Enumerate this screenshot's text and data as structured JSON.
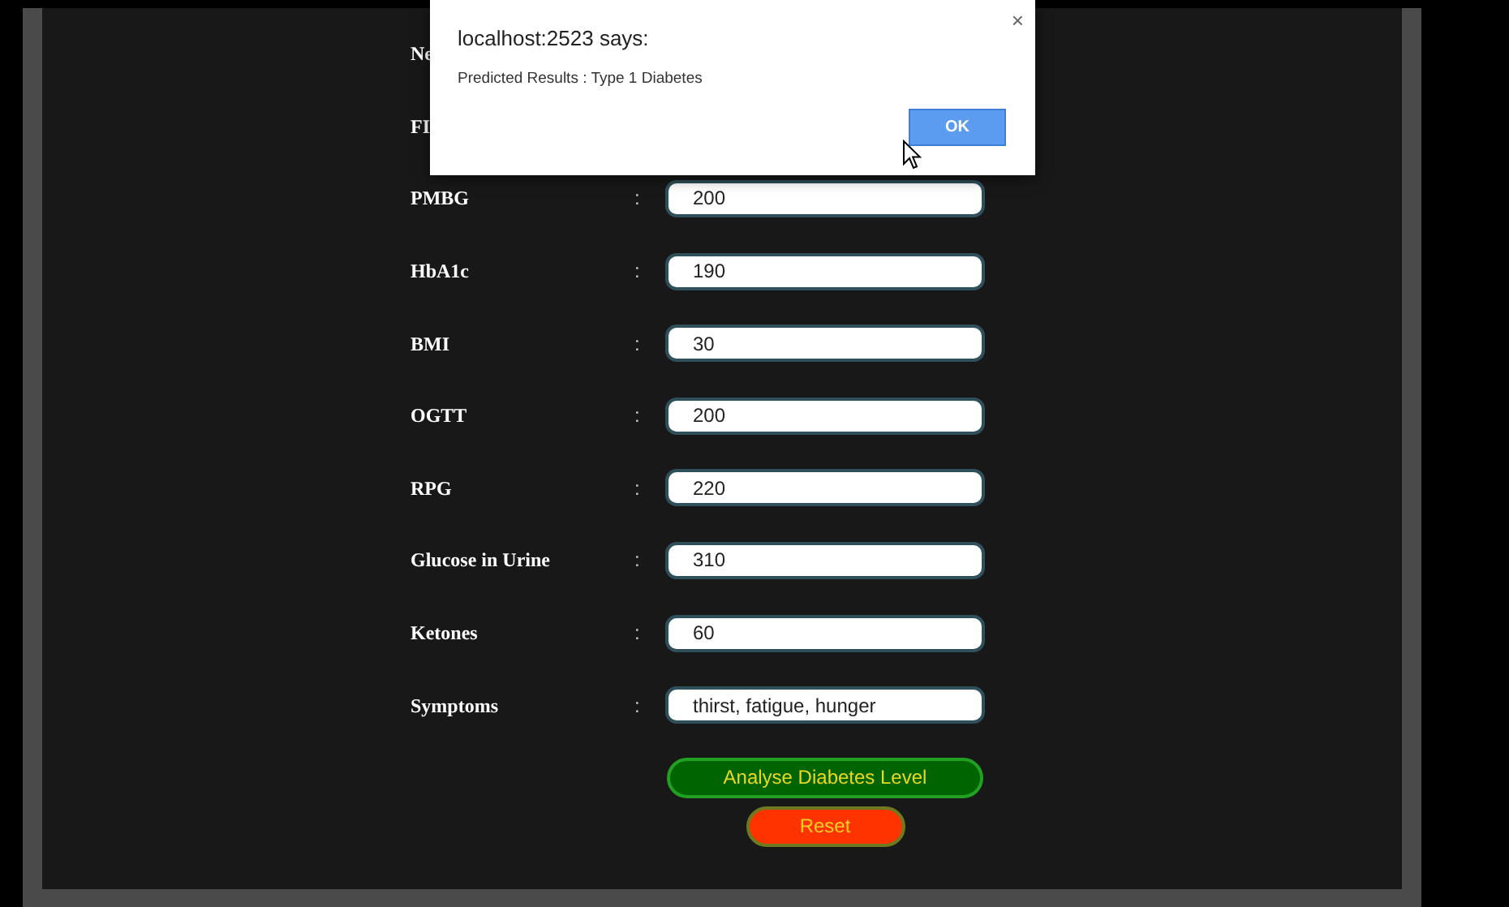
{
  "form": {
    "rows": [
      {
        "label": "Ne"
      },
      {
        "label": "FI"
      },
      {
        "label": "PMBG",
        "separator": ":",
        "value": "200"
      },
      {
        "label": "HbA1c",
        "separator": ":",
        "value": "190"
      },
      {
        "label": "BMI",
        "separator": ":",
        "value": "30"
      },
      {
        "label": "OGTT",
        "separator": ":",
        "value": "200"
      },
      {
        "label": "RPG",
        "separator": ":",
        "value": "220"
      },
      {
        "label": "Glucose in Urine",
        "separator": ":",
        "value": "310"
      },
      {
        "label": "Ketones",
        "separator": ":",
        "value": "60"
      },
      {
        "label": "Symptoms",
        "separator": ":",
        "value": "thirst, fatigue, hunger"
      }
    ],
    "buttons": [
      {
        "label": "Analyse Diabetes Level",
        "kind": "submit"
      },
      {
        "label": "Reset",
        "kind": "reset"
      }
    ]
  },
  "alert_dialog": {
    "title": "localhost:2523 says:",
    "message": "Predicted Results : Type 1 Diabetes",
    "close": "×",
    "ok": "OK"
  }
}
